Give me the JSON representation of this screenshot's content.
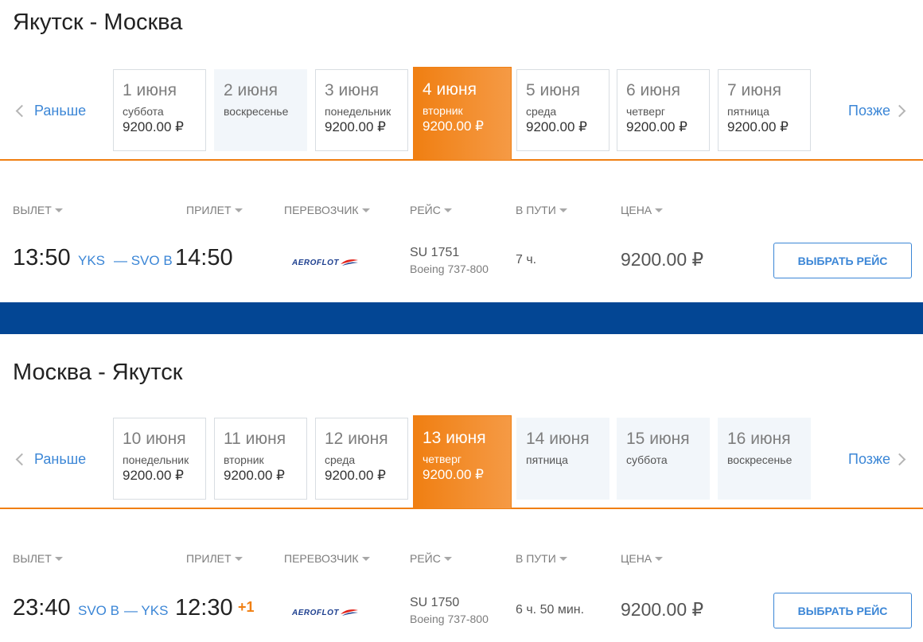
{
  "colors": {
    "accent": "#f07f12",
    "link": "#3b86d6",
    "band": "#034694"
  },
  "nav": {
    "earlier": "Раньше",
    "later": "Позже"
  },
  "headers": {
    "departure": "ВЫЛЕТ",
    "arrival": "ПРИЛЕТ",
    "carrier": "ПЕРЕВОЗЧИК",
    "flight": "РЕЙС",
    "duration": "В ПУТИ",
    "price": "ЦЕНА"
  },
  "select_label": "ВЫБРАТЬ РЕЙС",
  "carrier_logo_text": "AEROFLOT",
  "outbound": {
    "title": "Якутск - Москва",
    "dates": [
      {
        "date": "1 июня",
        "weekday": "суббота",
        "price": "9200.00 ₽"
      },
      {
        "date": "2 июня",
        "weekday": "воскресенье",
        "price": ""
      },
      {
        "date": "3 июня",
        "weekday": "понедельник",
        "price": "9200.00 ₽"
      },
      {
        "date": "4 июня",
        "weekday": "вторник",
        "price": "9200.00 ₽",
        "active": true
      },
      {
        "date": "5 июня",
        "weekday": "среда",
        "price": "9200.00 ₽"
      },
      {
        "date": "6 июня",
        "weekday": "четверг",
        "price": "9200.00 ₽"
      },
      {
        "date": "7 июня",
        "weekday": "пятница",
        "price": "9200.00 ₽"
      }
    ],
    "flight": {
      "dep_time": "13:50",
      "dep_airport": "YKS",
      "arr_airport": "— SVO B",
      "arr_time": "14:50",
      "next_day": "",
      "flight_no": "SU 1751",
      "aircraft": "Boeing 737-800",
      "duration": "7 ч.",
      "price": "9200.00 ₽"
    }
  },
  "return": {
    "title": "Москва - Якутск",
    "dates": [
      {
        "date": "10 июня",
        "weekday": "понедельник",
        "price": "9200.00 ₽"
      },
      {
        "date": "11 июня",
        "weekday": "вторник",
        "price": "9200.00 ₽"
      },
      {
        "date": "12 июня",
        "weekday": "среда",
        "price": "9200.00 ₽"
      },
      {
        "date": "13 июня",
        "weekday": "четверг",
        "price": "9200.00 ₽",
        "active": true
      },
      {
        "date": "14 июня",
        "weekday": "пятница",
        "price": ""
      },
      {
        "date": "15 июня",
        "weekday": "суббота",
        "price": ""
      },
      {
        "date": "16 июня",
        "weekday": "воскресенье",
        "price": ""
      }
    ],
    "flight": {
      "dep_time": "23:40",
      "dep_airport": "SVO B",
      "arr_airport": "— YKS",
      "arr_time": "12:30",
      "next_day": "+1",
      "flight_no": "SU 1750",
      "aircraft": "Boeing 737-800",
      "duration": "6 ч. 50 мин.",
      "price": "9200.00 ₽"
    }
  }
}
